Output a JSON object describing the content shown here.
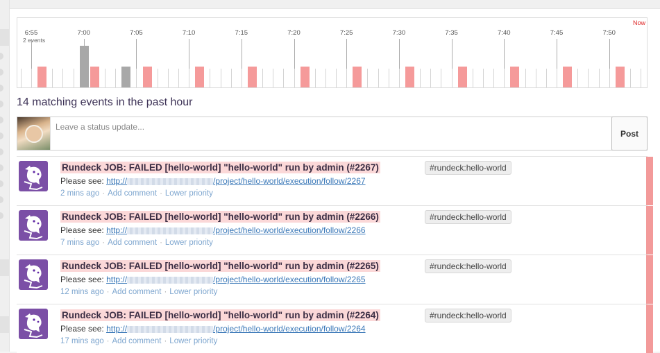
{
  "timeline": {
    "now_label": "Now",
    "events_label": "2 events",
    "ticks": [
      "6:55",
      "7:00",
      "7:05",
      "7:10",
      "7:15",
      "7:20",
      "7:25",
      "7:30",
      "7:35",
      "7:40",
      "7:45",
      "7:50"
    ]
  },
  "summary": "14 matching events in the past hour",
  "status": {
    "placeholder": "Leave a status update...",
    "post_label": "Post"
  },
  "events": [
    {
      "title": "Rundeck JOB: FAILED [hello-world] \"hello-world\" run by admin (#2267)",
      "tag": "#rundeck:hello-world",
      "body_prefix": "Please see:",
      "link_start": "http://",
      "link_end": "/project/hello-world/execution/follow/2267",
      "time": "2 mins ago",
      "add_comment": "Add comment",
      "lower_priority": "Lower priority"
    },
    {
      "title": "Rundeck JOB: FAILED [hello-world] \"hello-world\" run by admin (#2266)",
      "tag": "#rundeck:hello-world",
      "body_prefix": "Please see:",
      "link_start": "http://",
      "link_end": "/project/hello-world/execution/follow/2266",
      "time": "7 mins ago",
      "add_comment": "Add comment",
      "lower_priority": "Lower priority"
    },
    {
      "title": "Rundeck JOB: FAILED [hello-world] \"hello-world\" run by admin (#2265)",
      "tag": "#rundeck:hello-world",
      "body_prefix": "Please see:",
      "link_start": "http://",
      "link_end": "/project/hello-world/execution/follow/2265",
      "time": "12 mins ago",
      "add_comment": "Add comment",
      "lower_priority": "Lower priority"
    },
    {
      "title": "Rundeck JOB: FAILED [hello-world] \"hello-world\" run by admin (#2264)",
      "tag": "#rundeck:hello-world",
      "body_prefix": "Please see:",
      "link_start": "http://",
      "link_end": "/project/hello-world/execution/follow/2264",
      "time": "17 mins ago",
      "add_comment": "Add comment",
      "lower_priority": "Lower priority"
    }
  ],
  "colors": {
    "failed": "#f59a9a",
    "other": "#a8a8a8",
    "accent": "#3a78b8"
  }
}
